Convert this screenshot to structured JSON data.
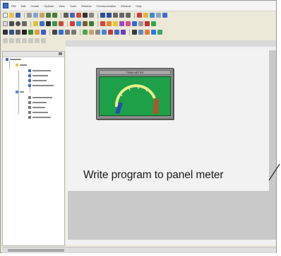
{
  "window": {
    "menu_items": [
      "File",
      "Edit",
      "Create",
      "Options",
      "View",
      "Tools",
      "Window",
      "Communication",
      "Window",
      "Help"
    ]
  },
  "meter": {
    "title": "TRIM METER",
    "colors": {
      "face": "#1ea048",
      "needle_left": "#1f4fb5",
      "needle_right": "#b5522e",
      "arc": "#e9f08a"
    }
  },
  "annotation": {
    "text": "Write program to panel meter"
  }
}
